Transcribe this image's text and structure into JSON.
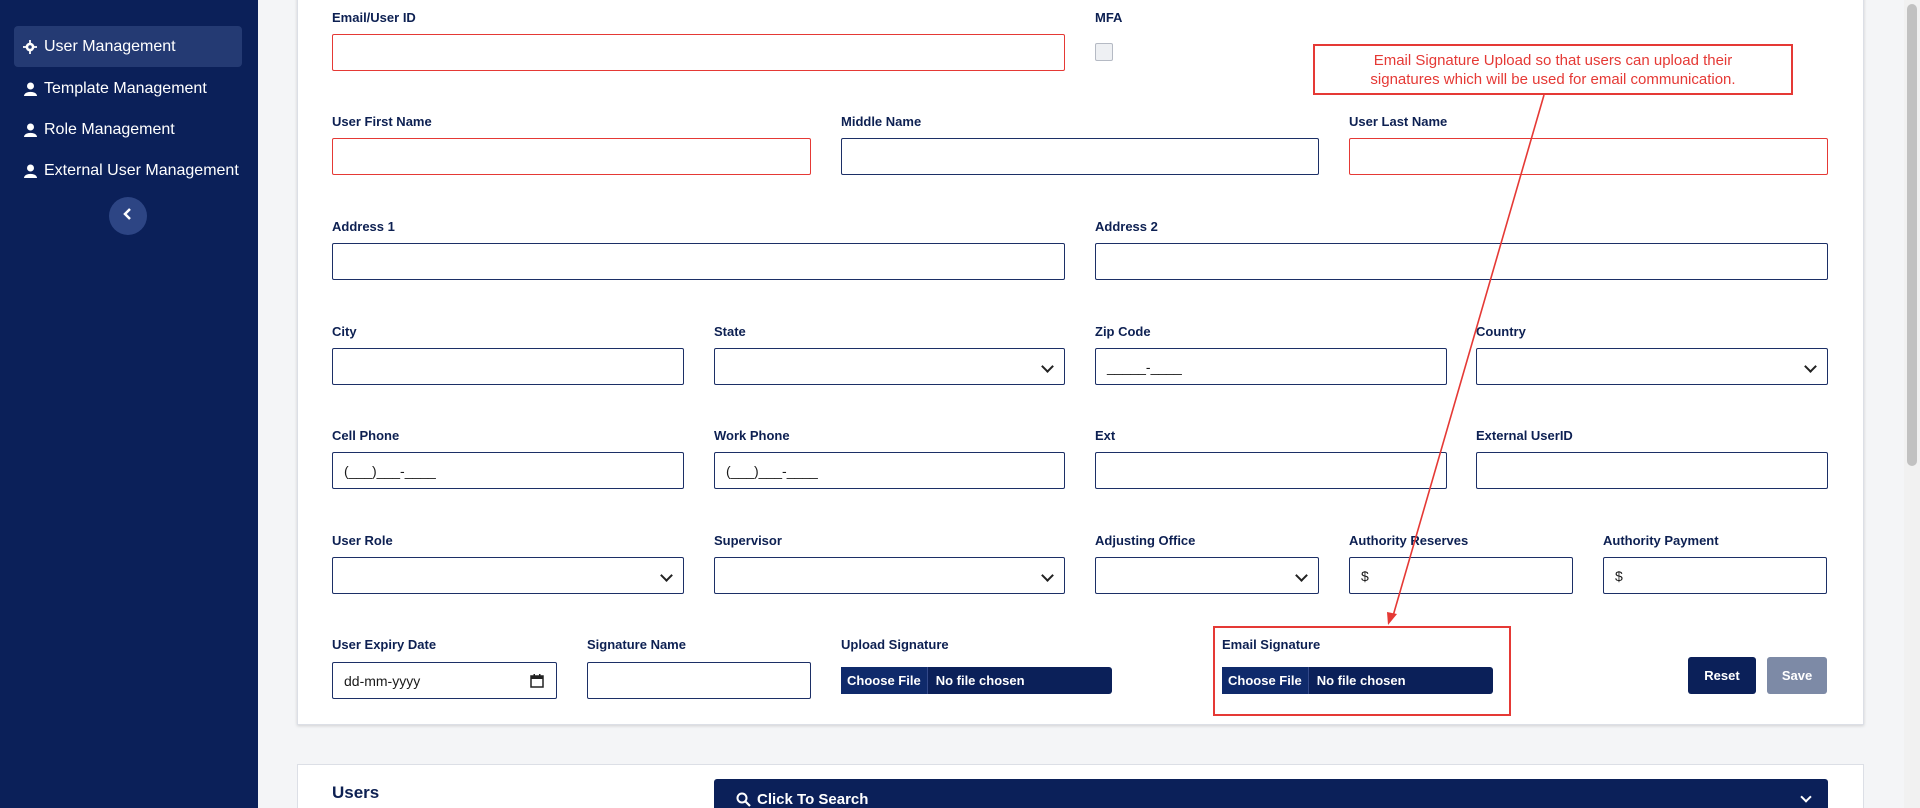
{
  "sidebar": {
    "items": [
      {
        "label": "User Management",
        "icon": "gear-icon",
        "active": true
      },
      {
        "label": "Template Management",
        "icon": "user-icon"
      },
      {
        "label": "Role Management",
        "icon": "user-icon"
      },
      {
        "label": "External User Management",
        "icon": "user-icon"
      }
    ],
    "collapse_icon": "chevron-left-icon"
  },
  "form": {
    "email_label": "Email/User ID",
    "mfa_label": "MFA",
    "first_name_label": "User First Name",
    "middle_name_label": "Middle Name",
    "last_name_label": "User Last Name",
    "address1_label": "Address 1",
    "address2_label": "Address 2",
    "city_label": "City",
    "state_label": "State",
    "zip_label": "Zip Code",
    "zip_value": "_____-____",
    "country_label": "Country",
    "cell_label": "Cell Phone",
    "cell_value": "(___)___-____",
    "work_label": "Work Phone",
    "work_value": "(___)___-____",
    "ext_label": "Ext",
    "external_id_label": "External UserID",
    "role_label": "User Role",
    "supervisor_label": "Supervisor",
    "office_label": "Adjusting Office",
    "reserves_label": "Authority Reserves",
    "reserves_value": "$",
    "payment_label": "Authority Payment",
    "payment_value": "$",
    "expiry_label": "User Expiry Date",
    "expiry_value": "dd-mm-yyyy",
    "sig_name_label": "Signature Name",
    "upload_sig_label": "Upload Signature",
    "email_sig_label": "Email Signature",
    "choose_file": "Choose File",
    "no_file": "No file chosen",
    "reset": "Reset",
    "save": "Save"
  },
  "annotation": {
    "line1": "Email Signature Upload so that users can upload their",
    "line2": "signatures which will be used for email communication.",
    "color": "#e53935"
  },
  "users": {
    "title": "Users",
    "search_label": "Click To Search"
  },
  "colors": {
    "navy": "#0b2059",
    "required_border": "#e53935"
  }
}
